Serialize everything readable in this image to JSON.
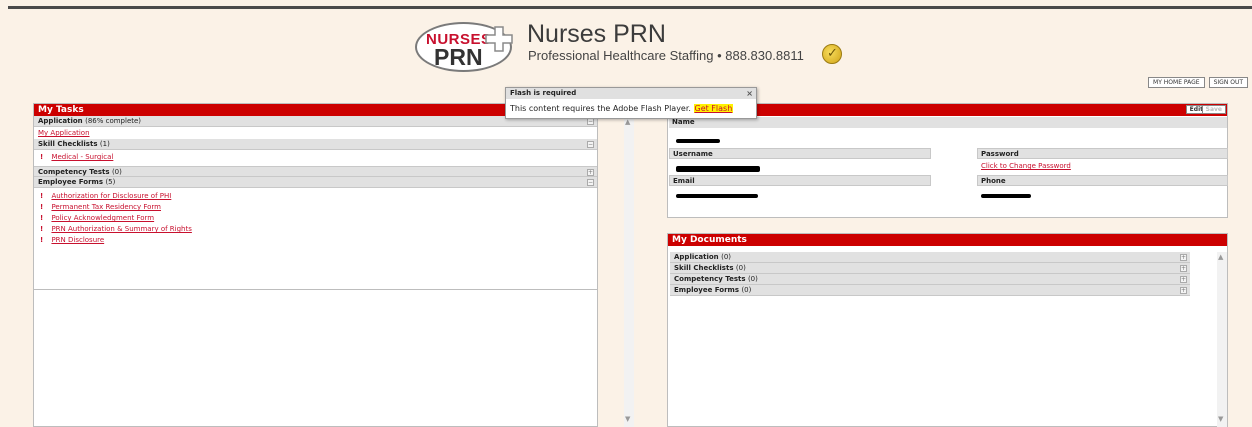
{
  "brand": {
    "logo_word1": "NURSES",
    "logo_word2": "PRN",
    "title": "Nurses PRN",
    "subtitle": "Professional Healthcare Staffing  •  888.830.8811",
    "accent_color": "#cc0000"
  },
  "topnav": {
    "home_label": "MY HOME PAGE",
    "signout_label": "SIGN OUT"
  },
  "tasks": {
    "title": "My Tasks",
    "sections": [
      {
        "label": "Application",
        "count": "(86% complete)",
        "toggle": "−"
      },
      {
        "label": "Skill Checklists",
        "count": "(1)",
        "toggle": "−"
      },
      {
        "label": "Competency Tests",
        "count": "(0)",
        "toggle": "+"
      },
      {
        "label": "Employee Forms",
        "count": "(5)",
        "toggle": "−"
      }
    ],
    "application_link": "My Application",
    "skill_items": [
      "Medical - Surgical"
    ],
    "form_items": [
      "Authorization for Disclosure of PHI",
      "Permanent Tax Residency Form",
      "Policy Acknowledgment Form",
      "PRN Authorization & Summary of Rights",
      "PRN Disclosure"
    ],
    "bang_icon": "!"
  },
  "profile": {
    "edit_label": "Edit",
    "save_label": "Save",
    "name_label": "Name",
    "username_label": "Username",
    "password_label": "Password",
    "password_link": "Click to Change Password",
    "email_label": "Email",
    "phone_label": "Phone"
  },
  "documents": {
    "title": "My Documents",
    "sections": [
      {
        "label": "Application",
        "count": "(0)",
        "toggle": "+"
      },
      {
        "label": "Skill Checklists",
        "count": "(0)",
        "toggle": "+"
      },
      {
        "label": "Competency Tests",
        "count": "(0)",
        "toggle": "+"
      },
      {
        "label": "Employee Forms",
        "count": "(0)",
        "toggle": "+"
      }
    ]
  },
  "flash": {
    "title": "Flash is required",
    "close": "×",
    "message": "This content requires the Adobe Flash Player.",
    "link": "Get Flash"
  }
}
